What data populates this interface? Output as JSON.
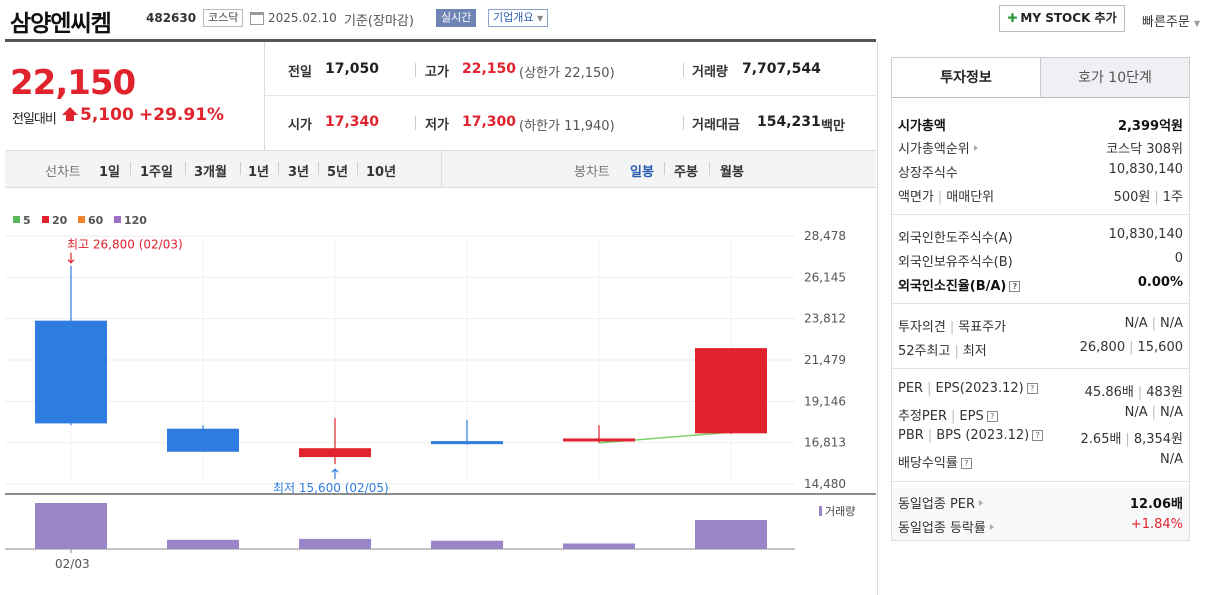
{
  "header": {
    "title": "삼양엔씨켐",
    "code": "482630",
    "market": "코스닥",
    "date": "2025.02.10",
    "basis": "기준(장마감)",
    "realtime": "실시간",
    "company_info": "기업개요",
    "mystock_label": "MY STOCK 추가",
    "quick_order": "빠른주문"
  },
  "price": {
    "current": "22,150",
    "change_label": "전일대비",
    "change": "5,100",
    "change_pct": "+29.91%"
  },
  "quote": {
    "prev_label": "전일",
    "prev": "17,050",
    "high_label": "고가",
    "high": "22,150",
    "upper_limit": "(상한가 22,150)",
    "volume_label": "거래량",
    "volume": "7,707,544",
    "open_label": "시가",
    "open": "17,340",
    "low_label": "저가",
    "low": "17,300",
    "lower_limit": "(하한가 11,940)",
    "amount_label": "거래대금",
    "amount": "154,231",
    "amount_unit": "백만"
  },
  "period_bar": {
    "line_label": "선차트",
    "line_periods": [
      "1일",
      "1주일",
      "3개월",
      "1년",
      "3년",
      "5년",
      "10년"
    ],
    "candle_label": "봉차트",
    "candle_periods": [
      "일봉",
      "주봉",
      "월봉"
    ],
    "active_candle": "일봉"
  },
  "chart_data": {
    "type": "candlestick",
    "legend": [
      {
        "name": "5",
        "color": "#5cb85c"
      },
      {
        "name": "20",
        "color": "#e0232d"
      },
      {
        "name": "60",
        "color": "#f0822c"
      },
      {
        "name": "120",
        "color": "#9b6fc4"
      }
    ],
    "y_ticks": [
      "28,478",
      "26,145",
      "23,812",
      "21,479",
      "19,146",
      "16,813",
      "14,480"
    ],
    "ylim": [
      14480,
      28478
    ],
    "candles": [
      {
        "open": 23700,
        "high": 26800,
        "low": 17800,
        "close": 17900,
        "dir": "down"
      },
      {
        "open": 17600,
        "high": 17800,
        "low": 16300,
        "close": 16300,
        "dir": "down"
      },
      {
        "open": 16000,
        "high": 18200,
        "low": 15600,
        "close": 16500,
        "dir": "up"
      },
      {
        "open": 16900,
        "high": 18100,
        "low": 16700,
        "close": 16750,
        "dir": "down"
      },
      {
        "open": 16900,
        "high": 17800,
        "low": 16800,
        "close": 17050,
        "dir": "up"
      },
      {
        "open": 17340,
        "high": 22150,
        "low": 17300,
        "close": 22150,
        "dir": "up"
      }
    ],
    "ma5_line": [
      {
        "index": 4,
        "value": 16800
      },
      {
        "index": 5,
        "value": 17400
      }
    ],
    "high_annotation": "최고 26,800 (02/03)",
    "low_annotation": "최저 15,600 (02/05)",
    "volume_label": "거래량",
    "volumes": [
      1.0,
      0.2,
      0.22,
      0.18,
      0.12,
      0.63
    ],
    "x_label": "02/03"
  },
  "invest": {
    "tab_active": "투자정보",
    "tab_other": "호가 10단계",
    "market_cap_label": "시가총액",
    "market_cap": "2,399억원",
    "market_cap_rank_label": "시가총액순위",
    "market_cap_rank": "코스닥 308위",
    "listed_shares_label": "상장주식수",
    "listed_shares": "10,830,140",
    "par_label": "액면가",
    "unit_label": "매매단위",
    "par": "500원",
    "unit": "1주",
    "foreign_limit_label": "외국인한도주식수(A)",
    "foreign_limit": "10,830,140",
    "foreign_hold_label": "외국인보유주식수(B)",
    "foreign_hold": "0",
    "foreign_ratio_label": "외국인소진율(B/A)",
    "foreign_ratio": "0.00%",
    "opinion_label": "투자의견",
    "target_label": "목표주가",
    "opinion": "N/A",
    "target": "N/A",
    "w52_high_label": "52주최고",
    "w52_low_label": "최저",
    "w52_high": "26,800",
    "w52_low": "15,600",
    "per_label": "PER",
    "eps_label": "EPS(2023.12)",
    "per": "45.86배",
    "eps": "483원",
    "est_per_label": "추정PER",
    "est_eps_label": "EPS",
    "est_per": "N/A",
    "est_eps": "N/A",
    "pbr_label": "PBR",
    "bps_label": "BPS (2023.12)",
    "pbr": "2.65배",
    "bps": "8,354원",
    "div_label": "배당수익률",
    "div": "N/A",
    "ind_per_label": "동일업종 PER",
    "ind_per": "12.06배",
    "ind_chg_label": "동일업종 등락률",
    "ind_chg": "+1.84%"
  }
}
